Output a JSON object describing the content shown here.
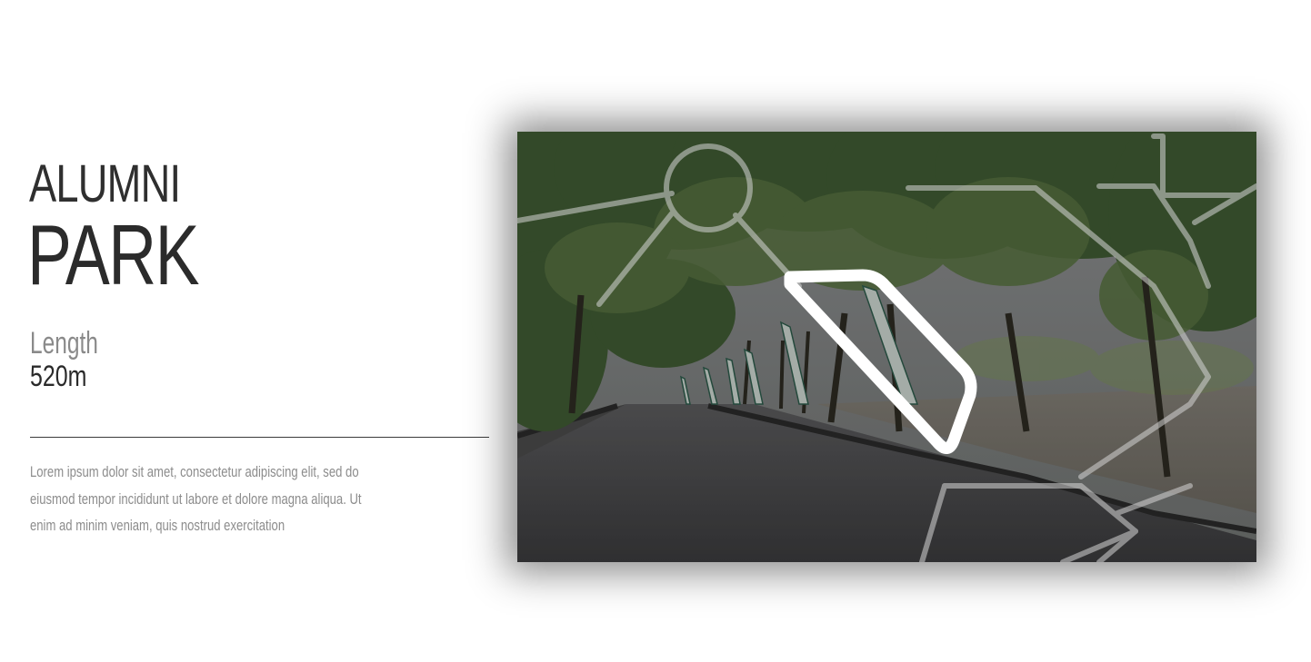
{
  "park": {
    "title_line1": "ALUMNI",
    "title_line2": "PARK",
    "stat_label": "Length",
    "stat_value": "520m",
    "description": "Lorem ipsum dolor sit amet, consectetur adipiscing elit, sed do eiusmod tempor incididunt ut labore et dolore magna aliqua. Ut enim ad minim veniam, quis nostrud exercitation"
  },
  "photo": {
    "subject": "tree-lined park road with banners",
    "overlay": "park map with highlighted route"
  },
  "colors": {
    "title": "#2f2f2f",
    "muted": "#8a8a8a",
    "route_highlight": "#ffffff",
    "map_lines": "#c8c8c8"
  }
}
